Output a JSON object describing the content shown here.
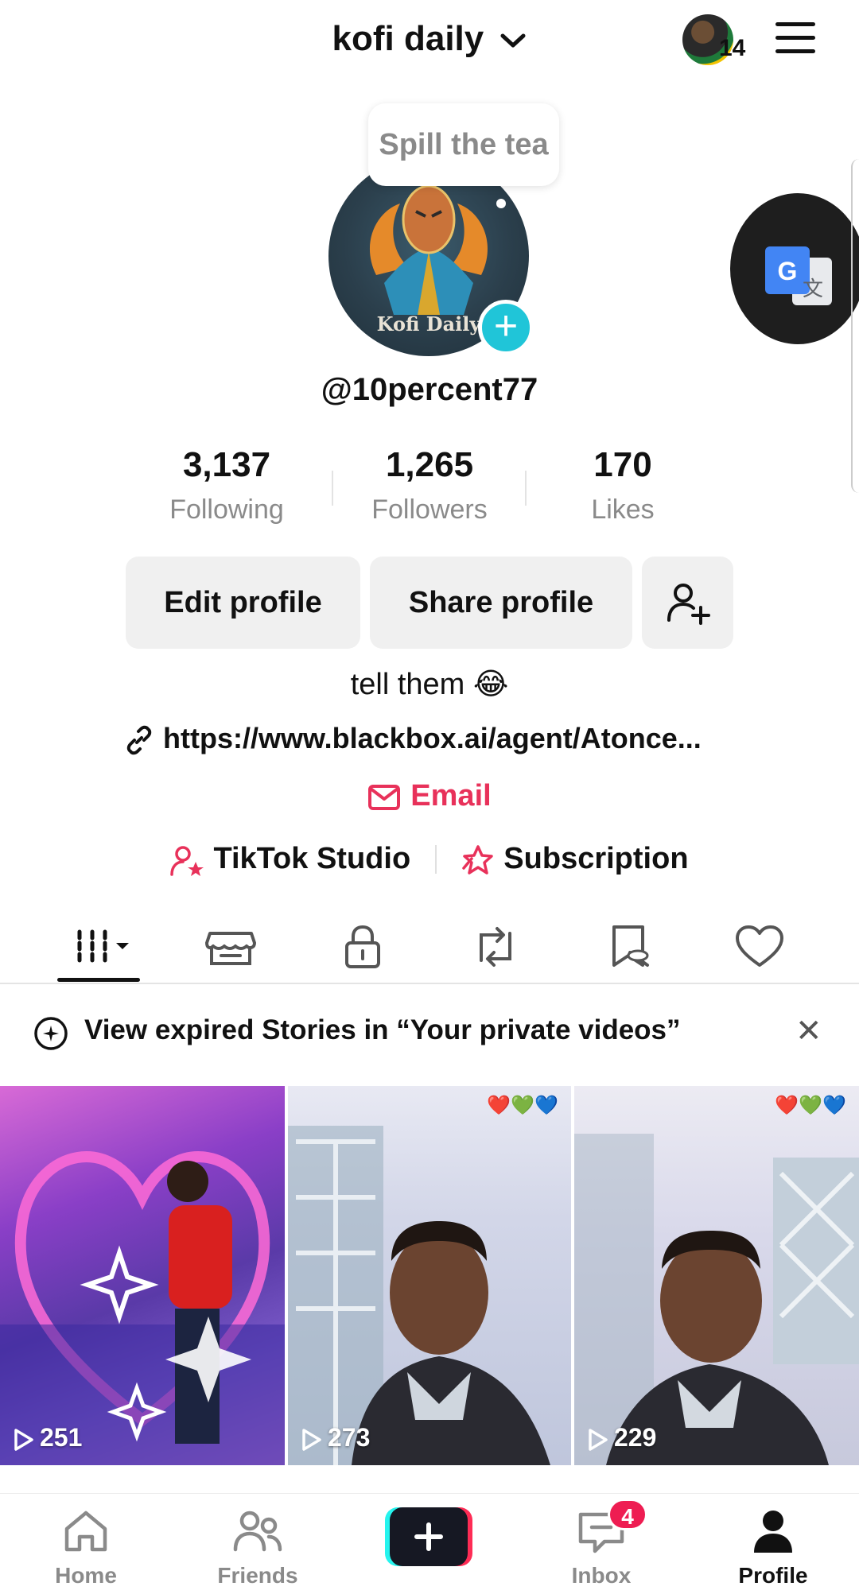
{
  "header": {
    "account_name": "kofi daily",
    "notification_count": "14"
  },
  "profile": {
    "bubble_text": "Spill the tea",
    "picture_label": "Kofi Daily",
    "username": "@10percent77",
    "stats": [
      {
        "value": "3,137",
        "label": "Following"
      },
      {
        "value": "1,265",
        "label": "Followers"
      },
      {
        "value": "170",
        "label": "Likes"
      }
    ],
    "buttons": {
      "edit": "Edit profile",
      "share": "Share profile"
    },
    "bio": "tell them 😂",
    "link": "https://www.blackbox.ai/agent/Atonce...",
    "email": "Email",
    "studio": "TikTok Studio",
    "subscription": "Subscription"
  },
  "banner": {
    "text": "View expired Stories in “Your private videos”"
  },
  "videos": [
    {
      "views": "251",
      "hearts": ""
    },
    {
      "views": "273",
      "hearts": "❤️💚💙"
    },
    {
      "views": "229",
      "hearts": "❤️💚💙"
    }
  ],
  "nav": {
    "home": "Home",
    "friends": "Friends",
    "inbox": "Inbox",
    "inbox_badge": "4",
    "profile": "Profile"
  },
  "colors": {
    "accent_red": "#e8315a",
    "teal": "#20c5d8",
    "badge_red": "#ee1d52"
  }
}
